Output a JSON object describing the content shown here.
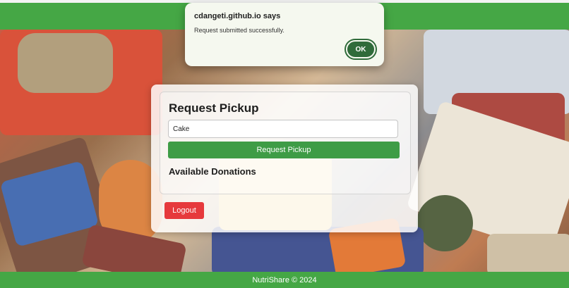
{
  "dialog": {
    "title": "cdangeti.github.io says",
    "message": "Request submitted successfully.",
    "ok_label": "OK"
  },
  "card": {
    "title": "Request Pickup",
    "input_value": "Cake",
    "request_button_label": "Request Pickup",
    "donations_heading": "Available Donations",
    "logout_label": "Logout"
  },
  "footer": {
    "text": "NutriShare © 2024"
  },
  "colors": {
    "brand_green": "#45a745",
    "button_green": "#3e9c46",
    "logout_red": "#e6393c",
    "dialog_ok": "#2f6b3a"
  }
}
